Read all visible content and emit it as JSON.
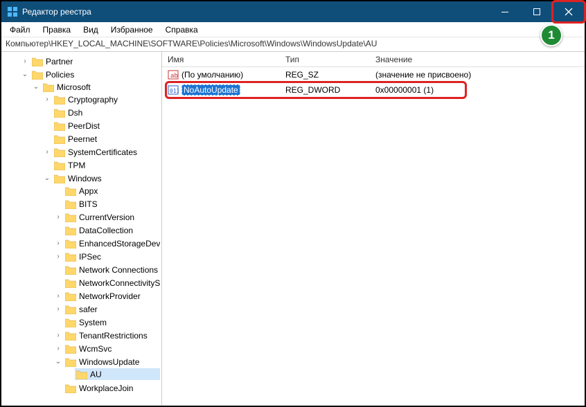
{
  "window": {
    "title": "Редактор реестра",
    "min_tip": "Свернуть",
    "max_tip": "Развернуть",
    "close_tip": "Закрыть"
  },
  "step_badge": "1",
  "menu": {
    "file": "Файл",
    "edit": "Правка",
    "view": "Вид",
    "favorites": "Избранное",
    "help": "Справка"
  },
  "address": "Компьютер\\HKEY_LOCAL_MACHINE\\SOFTWARE\\Policies\\Microsoft\\Windows\\WindowsUpdate\\AU",
  "tree": {
    "partner": "Partner",
    "policies": "Policies",
    "microsoft": "Microsoft",
    "cryptography": "Cryptography",
    "dsh": "Dsh",
    "peerdist": "PeerDist",
    "peernet": "Peernet",
    "systemcertificates": "SystemCertificates",
    "tpm": "TPM",
    "windows": "Windows",
    "appx": "Appx",
    "bits": "BITS",
    "currentversion": "CurrentVersion",
    "datacollection": "DataCollection",
    "enhancedstorage": "EnhancedStorageDevices",
    "ipsec": "IPSec",
    "networkconn1": "Network Connections",
    "networkconn2": "NetworkConnectivityStatusIndicator",
    "networkprov": "NetworkProvider",
    "safer": "safer",
    "system": "System",
    "tenantrestrict": "TenantRestrictions",
    "wcmsvc": "WcmSvc",
    "windowsupdate": "WindowsUpdate",
    "au": "AU",
    "workplacejoin": "WorkplaceJoin"
  },
  "columns": {
    "name": "Имя",
    "type": "Тип",
    "data": "Значение"
  },
  "values": {
    "default": {
      "name": "(По умолчанию)",
      "type": "REG_SZ",
      "data": "(значение не присвоено)"
    },
    "noauto": {
      "name": "NoAutoUpdate",
      "type": "REG_DWORD",
      "data": "0x00000001 (1)"
    }
  }
}
